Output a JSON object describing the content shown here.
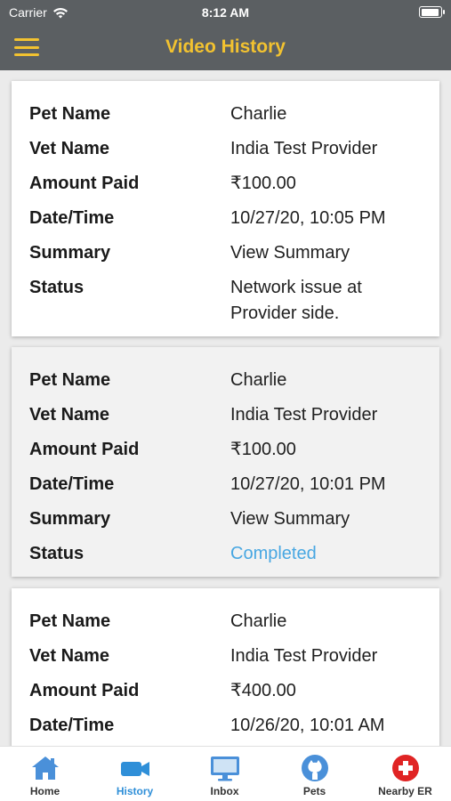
{
  "status_bar": {
    "carrier": "Carrier",
    "time": "8:12 AM"
  },
  "header": {
    "title": "Video History"
  },
  "labels": {
    "pet": "Pet Name",
    "vet": "Vet Name",
    "amount": "Amount Paid",
    "datetime": "Date/Time",
    "summary": "Summary",
    "status": "Status"
  },
  "cards": [
    {
      "pet": "Charlie",
      "vet": "India Test Provider",
      "amount": "₹100.00",
      "datetime": "10/27/20, 10:05 PM",
      "summary": "View Summary",
      "status": "Network issue at Provider side."
    },
    {
      "pet": "Charlie",
      "vet": "India Test Provider",
      "amount": "₹100.00",
      "datetime": "10/27/20, 10:01 PM",
      "summary": "View Summary",
      "status": "Completed"
    },
    {
      "pet": "Charlie",
      "vet": "India Test Provider",
      "amount": "₹400.00",
      "datetime": "10/26/20, 10:01 AM"
    }
  ],
  "tabs": [
    {
      "label": "Home",
      "icon": "home-icon"
    },
    {
      "label": "History",
      "icon": "video-camera-icon",
      "active": true
    },
    {
      "label": "Inbox",
      "icon": "monitor-icon"
    },
    {
      "label": "Pets",
      "icon": "github-icon"
    },
    {
      "label": "Nearby ER",
      "icon": "medical-cross-icon"
    }
  ],
  "colors": {
    "bar": "#5b5f62",
    "accent": "#f2c230",
    "link": "#48a7e2",
    "active_tab": "#2f8fd8",
    "er_red": "#e02424"
  }
}
